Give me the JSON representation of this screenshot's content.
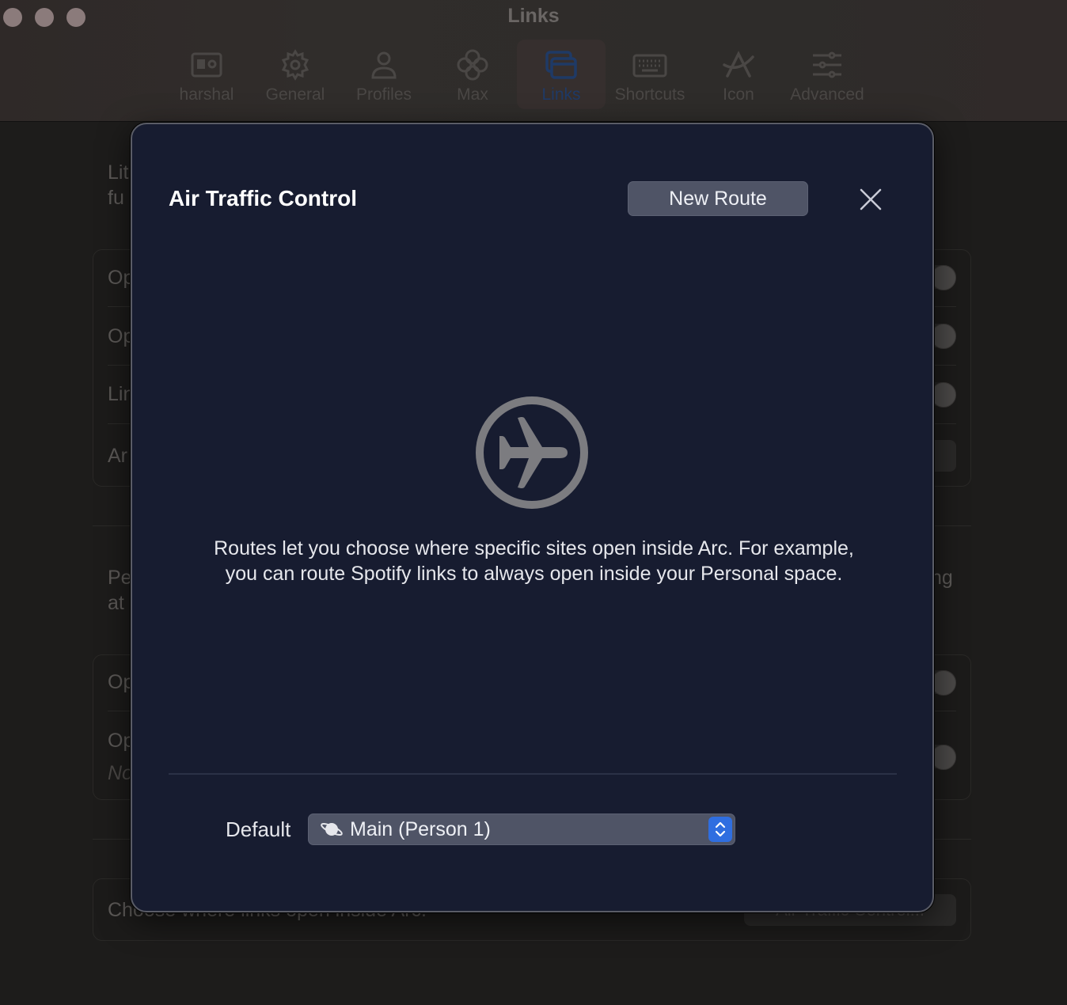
{
  "window": {
    "title": "Links",
    "traffic_lights": [
      "close",
      "minimize",
      "zoom"
    ]
  },
  "toolbar": {
    "tabs": [
      {
        "label": "harshal",
        "icon": "contact-card-icon",
        "active": false
      },
      {
        "label": "General",
        "icon": "gear-icon",
        "active": false
      },
      {
        "label": "Profiles",
        "icon": "person-icon",
        "active": false
      },
      {
        "label": "Max",
        "icon": "max-flower-icon",
        "active": false
      },
      {
        "label": "Links",
        "icon": "windows-icon",
        "active": true
      },
      {
        "label": "Shortcuts",
        "icon": "keyboard-icon",
        "active": false
      },
      {
        "label": "Icon",
        "icon": "arc-logo-icon",
        "active": false
      },
      {
        "label": "Advanced",
        "icon": "sliders-icon",
        "active": false
      }
    ],
    "active_color": "#1f3a66"
  },
  "background": {
    "intro_fragment": [
      "Lit",
      "fu"
    ],
    "card1_rows": [
      "Op",
      "Op",
      "Lin",
      "Ar"
    ],
    "section2_fragment": [
      "Pe",
      "at"
    ],
    "section2_right_fragment": "ng",
    "card2_rows": [
      "Op",
      "Op"
    ],
    "card2_subtext": "No",
    "bottom_row_text": "Choose where links open inside Arc.",
    "bottom_row_button": "Air Traffic Control..."
  },
  "modal": {
    "title": "Air Traffic Control",
    "new_route_label": "New Route",
    "close_icon": "close-icon",
    "empty_icon": "airplane-circle-icon",
    "description": "Routes let you choose where specific sites open inside Arc. For example, you can route Spotify links to always open inside your Personal space.",
    "default_label": "Default",
    "default_select": {
      "icon": "planet-icon",
      "value": "Main (Person 1)"
    },
    "colors": {
      "background": "#171c30",
      "button": "#4f5466",
      "stepper": "#2f6ee0"
    }
  }
}
